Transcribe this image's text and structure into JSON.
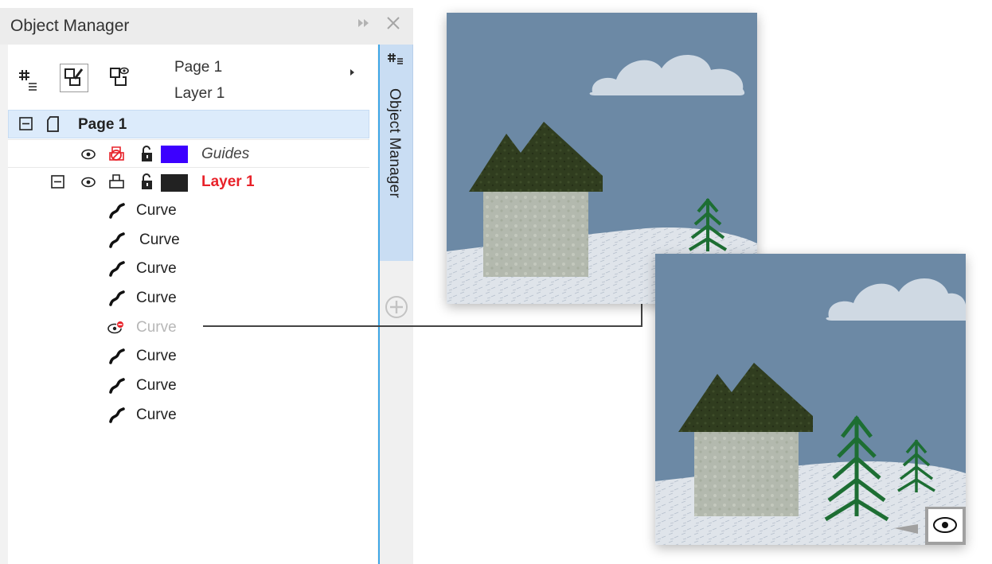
{
  "panel": {
    "title": "Object Manager",
    "float_icon": "double-chevron-right-icon",
    "close_icon": "close-icon"
  },
  "toolbar": {
    "tools": [
      {
        "name": "show-object-properties-icon",
        "selected": false
      },
      {
        "name": "edit-across-layers-icon",
        "selected": true
      },
      {
        "name": "layer-manager-view-icon",
        "selected": false
      }
    ],
    "breadcrumb_page": "Page 1",
    "breadcrumb_layer": "Layer 1"
  },
  "tree": {
    "page": {
      "label": "Page 1"
    },
    "guides": {
      "label": "Guides",
      "color": "#3c00ff"
    },
    "layer": {
      "label": "Layer 1",
      "color": "#222222",
      "label_color": "#e8222a"
    },
    "objects": [
      {
        "label": "Curve",
        "hidden": false
      },
      {
        "label": "Curve",
        "hidden": false
      },
      {
        "label": "Curve",
        "hidden": false
      },
      {
        "label": "Curve",
        "hidden": false
      },
      {
        "label": "Curve",
        "hidden": true
      },
      {
        "label": "Curve",
        "hidden": false
      },
      {
        "label": "Curve",
        "hidden": false
      },
      {
        "label": "Curve",
        "hidden": false
      }
    ]
  },
  "side_tab": {
    "label": "Object Manager",
    "icon": "object-manager-tab-icon",
    "add_icon": "add-docker-icon"
  },
  "illustrations": {
    "before_badge_icon": "hidden-eye-icon",
    "after_badge_icon": "eye-icon",
    "colors": {
      "sky": "#6c89a5",
      "roof": "#303d1f",
      "wall": "#b3b9ae",
      "snow": "#dde3ea",
      "tree": "#1d6e33",
      "cloud": "#cfd9e3"
    }
  }
}
